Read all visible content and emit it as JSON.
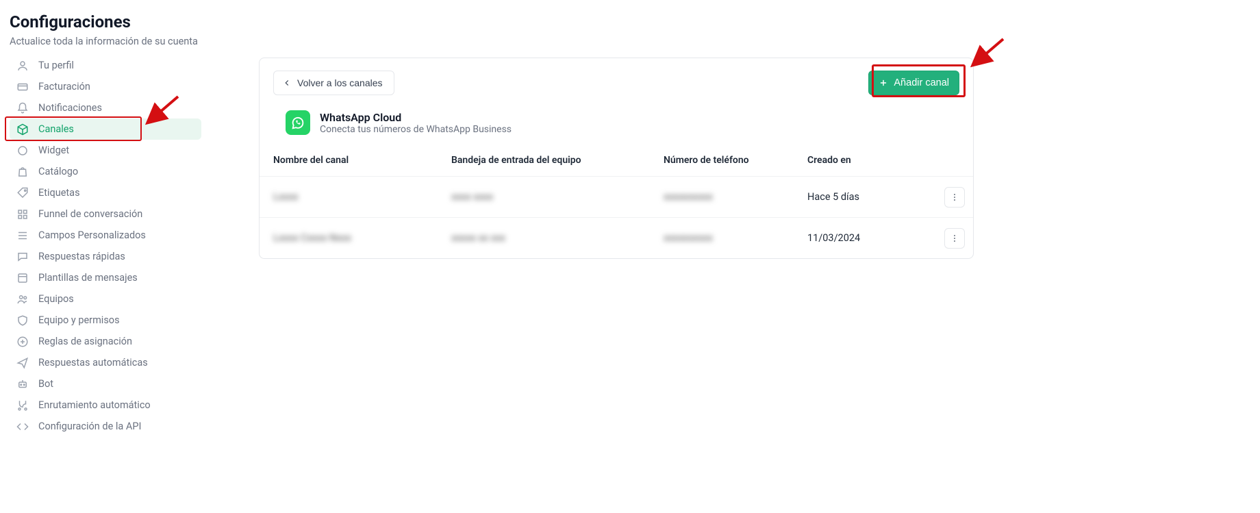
{
  "header": {
    "title": "Configuraciones",
    "subtitle": "Actualice toda la información de su cuenta"
  },
  "sidebar": {
    "items": [
      {
        "label": "Tu perfil"
      },
      {
        "label": "Facturación"
      },
      {
        "label": "Notificaciones"
      },
      {
        "label": "Canales"
      },
      {
        "label": "Widget"
      },
      {
        "label": "Catálogo"
      },
      {
        "label": "Etiquetas"
      },
      {
        "label": "Funnel de conversación"
      },
      {
        "label": "Campos Personalizados"
      },
      {
        "label": "Respuestas rápidas"
      },
      {
        "label": "Plantillas de mensajes"
      },
      {
        "label": "Equipos"
      },
      {
        "label": "Equipo y permisos"
      },
      {
        "label": "Reglas de asignación"
      },
      {
        "label": "Respuestas automáticas"
      },
      {
        "label": "Bot"
      },
      {
        "label": "Enrutamiento automático"
      },
      {
        "label": "Configuración de la API"
      }
    ]
  },
  "card": {
    "back_label": "Volver a los canales",
    "add_label": "Añadir canal",
    "channel_title": "WhatsApp Cloud",
    "channel_subtitle": "Conecta tus números de WhatsApp Business",
    "columns": {
      "name": "Nombre del canal",
      "inbox": "Bandeja de entrada del equipo",
      "phone": "Número de teléfono",
      "created": "Creado en"
    },
    "rows": [
      {
        "name": "Lxxxx",
        "inbox": "xxxx  xxxx",
        "phone": "xxxxxxxxxx",
        "created": "Hace 5 días"
      },
      {
        "name": "Lxxxx   Cxxxx Nxxx",
        "inbox": "xxxxx  xx  xxx",
        "phone": "xxxxxxxxxx",
        "created": "11/03/2024"
      }
    ]
  }
}
